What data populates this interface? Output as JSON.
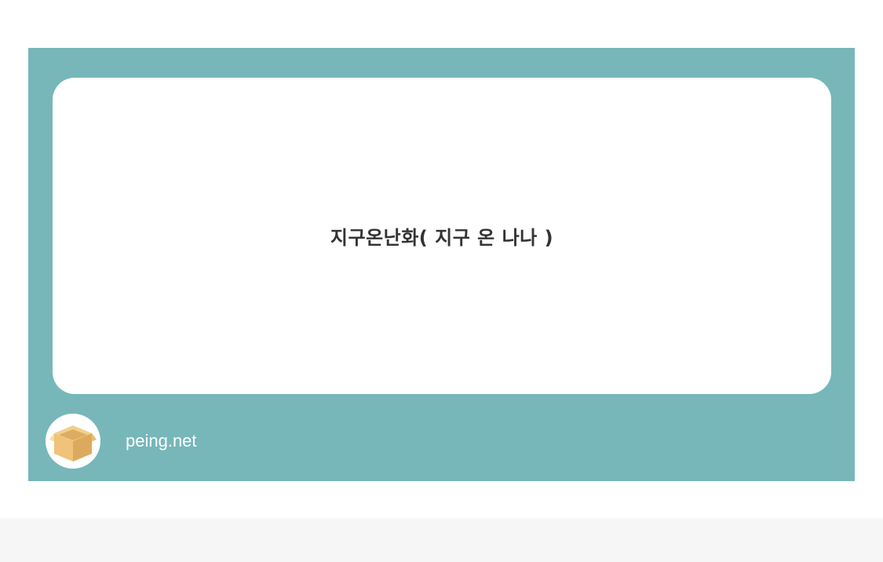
{
  "card": {
    "question": "지구온난화( 지구 온 나나 )",
    "footer": {
      "avatar_icon": "cardboard-box-icon",
      "brand": "peing.net"
    }
  },
  "colors": {
    "card_background": "#77b7b9",
    "question_background": "#ffffff",
    "question_text": "#333333",
    "brand_text": "#ffffff",
    "bottom_bar": "#f6f6f6"
  }
}
